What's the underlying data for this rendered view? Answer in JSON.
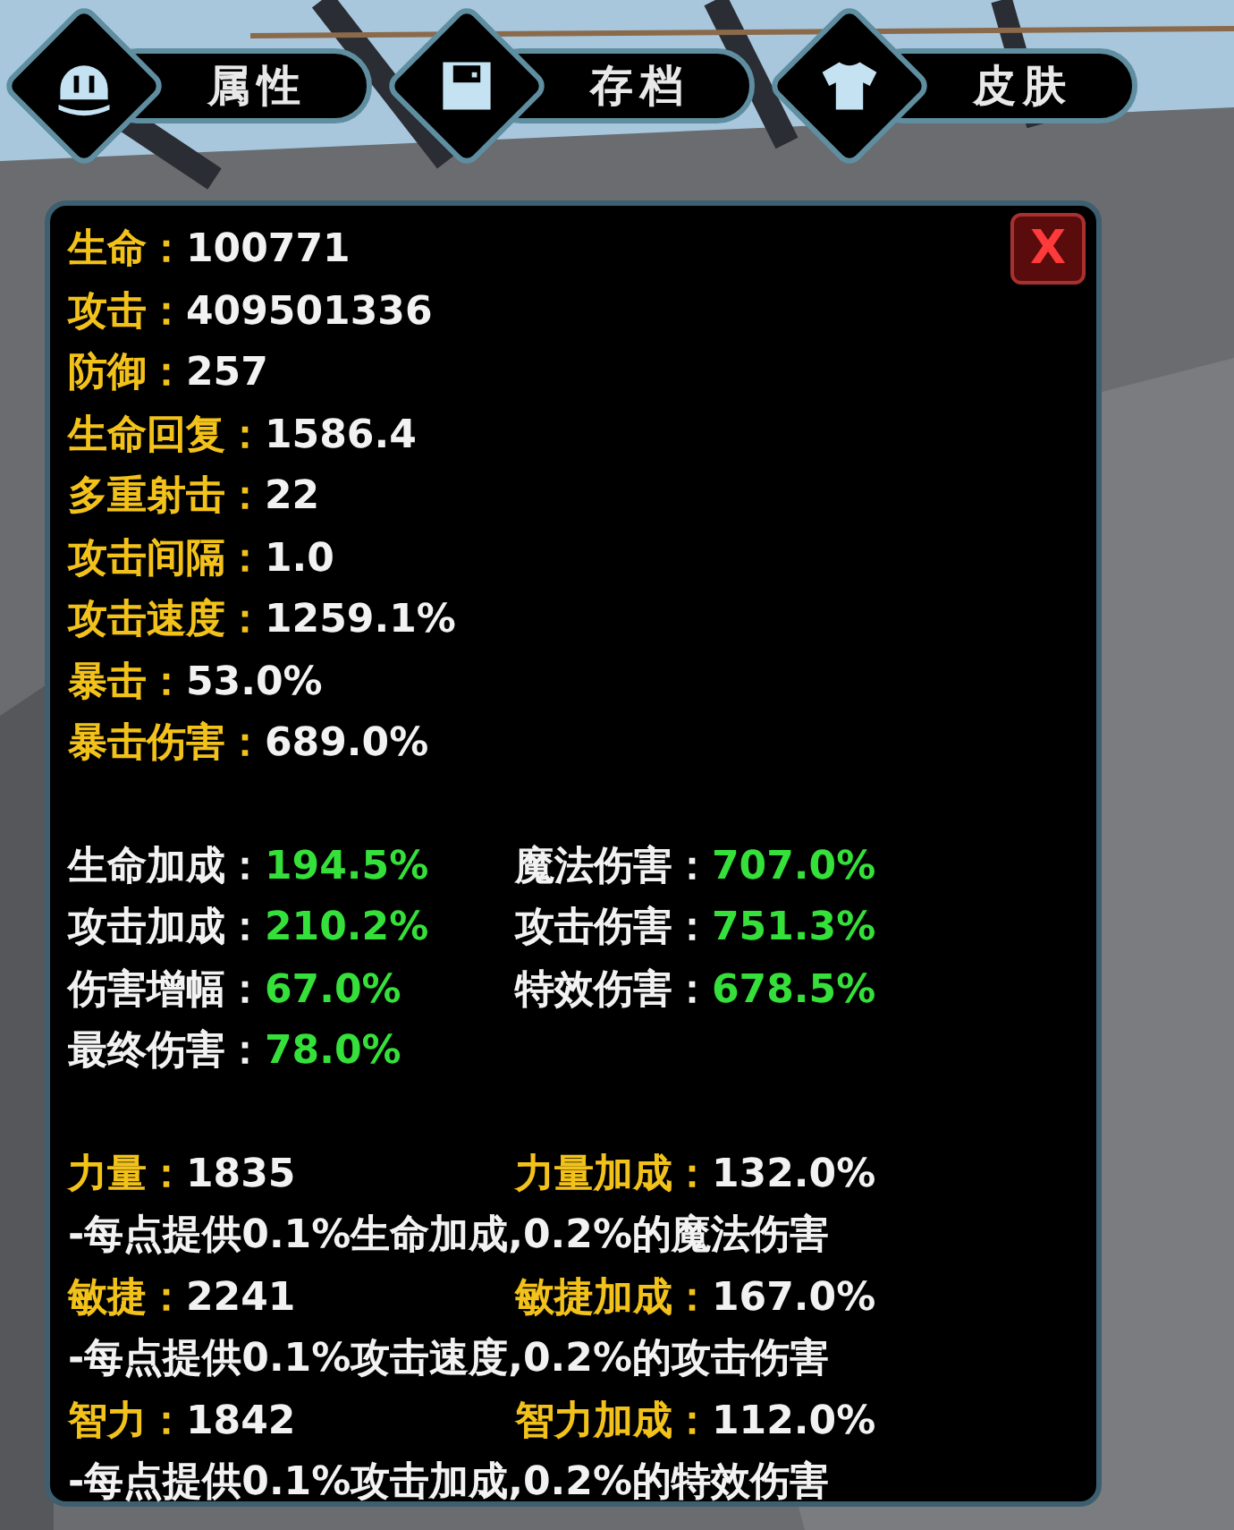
{
  "tabs": [
    {
      "label": "属性"
    },
    {
      "label": "存档"
    },
    {
      "label": "皮肤"
    }
  ],
  "panel": {
    "close": "X",
    "base_stats": [
      {
        "label": "生命：",
        "value": "100771"
      },
      {
        "label": "攻击：",
        "value": "409501336"
      },
      {
        "label": "防御：",
        "value": "257"
      },
      {
        "label": "生命回复：",
        "value": "1586.4"
      },
      {
        "label": "多重射击：",
        "value": "22"
      },
      {
        "label": "攻击间隔：",
        "value": "1.0"
      },
      {
        "label": "攻击速度：",
        "value": "1259.1%"
      },
      {
        "label": "暴击：",
        "value": "53.0%"
      },
      {
        "label": "暴击伤害：",
        "value": "689.0%"
      }
    ],
    "bonus_stats": [
      {
        "label": "生命加成：",
        "value": "194.5%"
      },
      {
        "label": "魔法伤害：",
        "value": "707.0%"
      },
      {
        "label": "攻击加成：",
        "value": "210.2%"
      },
      {
        "label": "攻击伤害：",
        "value": "751.3%"
      },
      {
        "label": "伤害增幅：",
        "value": "67.0%"
      },
      {
        "label": "特效伤害：",
        "value": "678.5%"
      },
      {
        "label": "最终伤害：",
        "value": "78.0%"
      }
    ],
    "attributes": [
      {
        "label": "力量：",
        "value": "1835",
        "bonus_label": "力量加成：",
        "bonus_value": "132.0%",
        "note": "-每点提供0.1%生命加成,0.2%的魔法伤害"
      },
      {
        "label": "敏捷：",
        "value": "2241",
        "bonus_label": "敏捷加成：",
        "bonus_value": "167.0%",
        "note": "-每点提供0.1%攻击速度,0.2%的攻击伤害"
      },
      {
        "label": "智力：",
        "value": "1842",
        "bonus_label": "智力加成：",
        "bonus_value": "112.0%",
        "note": "-每点提供0.1%攻击加成,0.2%的特效伤害"
      }
    ]
  }
}
